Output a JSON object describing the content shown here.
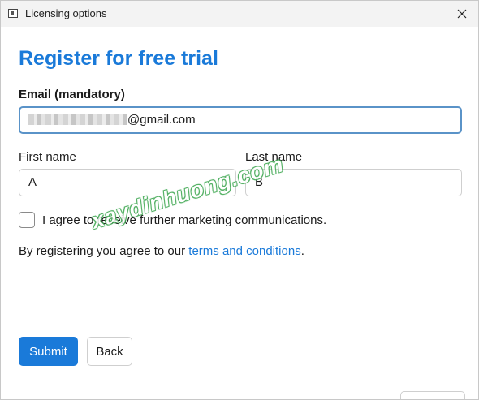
{
  "window": {
    "title": "Licensing options"
  },
  "form": {
    "heading": "Register for free trial",
    "email_label": "Email (mandatory)",
    "email_value": "@gmail.com",
    "first_name_label": "First name",
    "first_name_value": "A",
    "last_name_label": "Last name",
    "last_name_value": "B",
    "marketing_label": "I agree to receive further marketing communications.",
    "marketing_checked": false,
    "terms_prefix": "By registering you agree to our ",
    "terms_link": "terms and conditions",
    "terms_suffix": "."
  },
  "buttons": {
    "submit": "Submit",
    "back": "Back"
  },
  "watermark": "xaydinhuong.com",
  "colors": {
    "accent": "#1a7ad9",
    "focus_border": "#5a93c8",
    "watermark": "#3aa54d"
  },
  "icons": {
    "app": "app-window-icon",
    "close": "close-icon"
  }
}
